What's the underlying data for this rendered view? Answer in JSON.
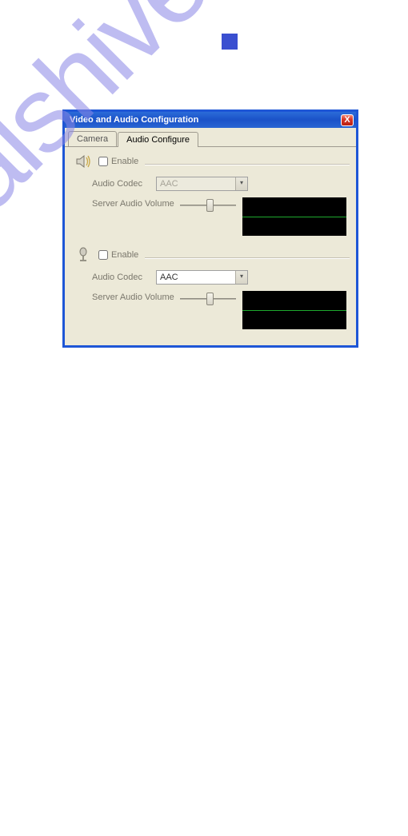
{
  "page": {
    "square_color": "#3a4fd0"
  },
  "watermark": {
    "text": "manualshive.com"
  },
  "dialog": {
    "title": "Video and Audio Configuration",
    "close_glyph": "X",
    "tabs": [
      {
        "label": "Camera"
      },
      {
        "label": "Audio Configure"
      }
    ],
    "sections": {
      "speaker": {
        "enable_label": "Enable",
        "enable_checked": false,
        "codec_label": "Audio Codec",
        "codec_value": "AAC",
        "volume_label": "Server Audio Volume",
        "slider_pos_pct": 55
      },
      "mic": {
        "enable_label": "Enable",
        "enable_checked": false,
        "codec_label": "Audio Codec",
        "codec_value": "AAC",
        "volume_label": "Server Audio Volume",
        "slider_pos_pct": 55
      }
    }
  }
}
